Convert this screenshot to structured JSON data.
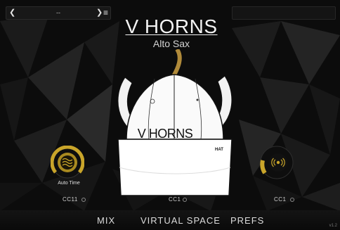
{
  "header": {
    "preset_name": "--",
    "prev_icon": "chevron-left",
    "next_icon": "chevron-right",
    "menu_icon": "hamburger-menu"
  },
  "product": {
    "title": "V HORNS",
    "subtitle": "Alto Sax",
    "hat_text": "V HORNS",
    "hat_tag": "HAT"
  },
  "controls": {
    "left_knob": {
      "label": "Auto Time",
      "cc": "CC11",
      "icon": "waves-icon"
    },
    "center": {
      "cc": "CC1"
    },
    "right_knob": {
      "cc": "CC1",
      "icon": "vibrato-icon"
    }
  },
  "nav": {
    "tabs": [
      "MIX",
      "VIRTUAL SPACE",
      "PREFS"
    ]
  },
  "version": "v1.2",
  "colors": {
    "gold": "#c9a52a",
    "background": "#0b0b0b",
    "text": "#e0e0e0"
  }
}
